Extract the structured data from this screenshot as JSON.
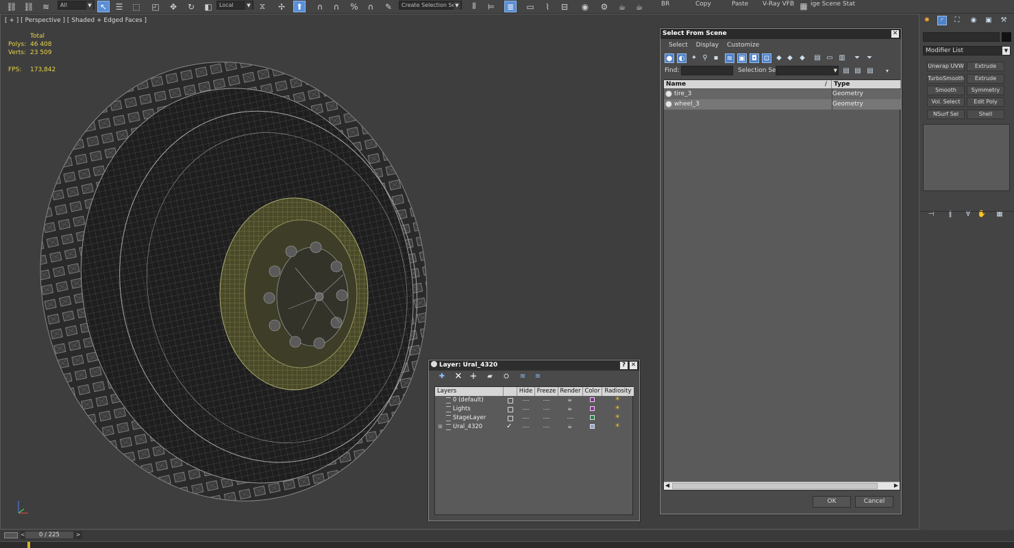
{
  "toolbar": {
    "filter_dropdown": "All",
    "coord_dropdown": "Local",
    "selection_set": "Create Selection Se",
    "actions": [
      "BR",
      "Copy",
      "Paste",
      "V-Ray VFB",
      "ige Scene Stat"
    ]
  },
  "viewport": {
    "label": "[ + ] [ Perspective ] [ Shaded + Edged Faces ]",
    "stats": {
      "total_label": "Total",
      "polys_label": "Polys:",
      "polys_value": "46 408",
      "verts_label": "Verts:",
      "verts_value": "23 509",
      "fps_label": "FPS:",
      "fps_value": "173,842"
    }
  },
  "select_from_scene": {
    "title": "Select From Scene",
    "menu": [
      "Select",
      "Display",
      "Customize"
    ],
    "find_label": "Find:",
    "find_value": "",
    "selection_set_label": "Selection Set:",
    "selection_set_value": "",
    "columns": {
      "name": "Name",
      "type": "Type"
    },
    "rows": [
      {
        "name": "tire_3",
        "type": "Geometry"
      },
      {
        "name": "wheel_3",
        "type": "Geometry"
      }
    ],
    "ok": "OK",
    "cancel": "Cancel"
  },
  "layer_dialog": {
    "title": "Layer: Ural_4320",
    "help": "?",
    "close": "✕",
    "columns": {
      "layers": "Layers",
      "hide": "Hide",
      "freeze": "Freeze",
      "render": "Render",
      "color": "Color",
      "radiosity": "Radiosity"
    },
    "rows": [
      {
        "name": "0 (default)",
        "color": "#8a2a9a",
        "current": false
      },
      {
        "name": "Lights",
        "color": "#9a2aa8",
        "current": false
      },
      {
        "name": "StageLayer",
        "color": "#1f8a4a",
        "current": false
      },
      {
        "name": "Ural_4320",
        "color": "#8fa6d8",
        "current": true
      }
    ]
  },
  "command_panel": {
    "modifier_list": "Modifier List",
    "modifiers": [
      [
        "Unwrap UVW",
        "Extrude"
      ],
      [
        "TurboSmooth",
        "Extrude"
      ],
      [
        "Smooth",
        "Symmetry"
      ],
      [
        "Vol. Select",
        "Edit Poly"
      ],
      [
        "NSurf Sel",
        "Shell"
      ]
    ]
  },
  "timeline": {
    "frame": "0 / 225",
    "next": ">",
    "prev": "<"
  },
  "colors": {
    "stat_yellow": "#e8d44a",
    "select_blue": "#4f82c8",
    "wire_green": "#8a8a4a"
  }
}
